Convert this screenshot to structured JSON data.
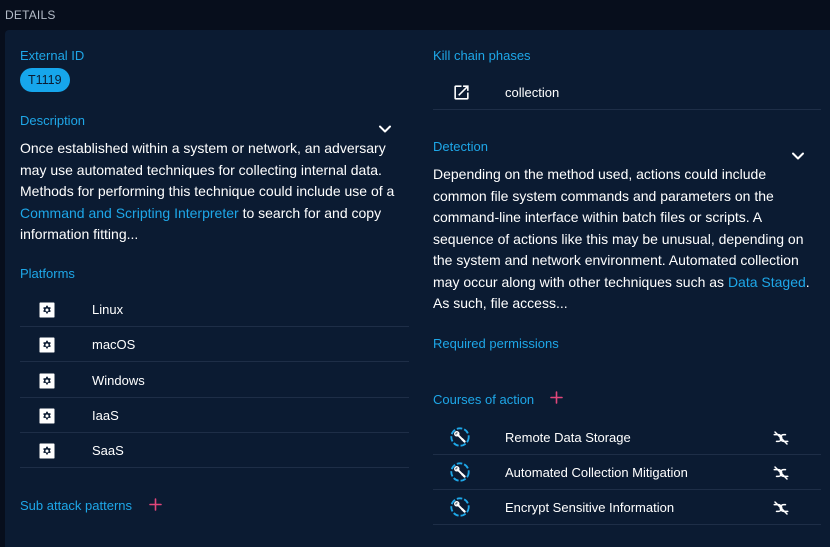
{
  "section": {
    "header": "DETAILS"
  },
  "left": {
    "external_id_label": "External ID",
    "external_id_value": "T1119",
    "description_label": "Description",
    "description_before_link": "Once established within a system or network, an adversary may use automated techniques for collecting internal data. Methods for performing this technique could include use of a",
    "description_link": "Command and Scripting Interpreter",
    "description_after_link": "to search for and copy information fitting...",
    "platforms_label": "Platforms",
    "platforms": [
      {
        "name": "Linux",
        "icon": "gear-icon"
      },
      {
        "name": "macOS",
        "icon": "gear-icon"
      },
      {
        "name": "Windows",
        "icon": "gear-icon"
      },
      {
        "name": "IaaS",
        "icon": "gear-icon"
      },
      {
        "name": "SaaS",
        "icon": "gear-icon"
      }
    ],
    "sub_attack_label": "Sub attack patterns"
  },
  "right": {
    "kill_chain_label": "Kill chain phases",
    "kill_chain_phase": "collection",
    "detection_label": "Detection",
    "detection_before_link": "Depending on the method used, actions could include common file system commands and parameters on the command-line interface within batch files or scripts. A sequence of actions like this may be unusual, depending on the system and network environment. Automated collection may occur along with other techniques such as",
    "detection_link": "Data Staged",
    "detection_after_link": ". As such, file access...",
    "required_permissions_label": "Required permissions",
    "courses_label": "Courses of action",
    "courses": [
      {
        "name": "Remote Data Storage"
      },
      {
        "name": "Automated Collection Mitigation"
      },
      {
        "name": "Encrypt Sensitive Information"
      }
    ]
  },
  "colors": {
    "background": "#070e1c",
    "panel": "#0b1b32",
    "accent": "#1ea7e8",
    "chip": "#16a6ec",
    "plus": "#e0467a",
    "divider": "#1e2e47"
  }
}
